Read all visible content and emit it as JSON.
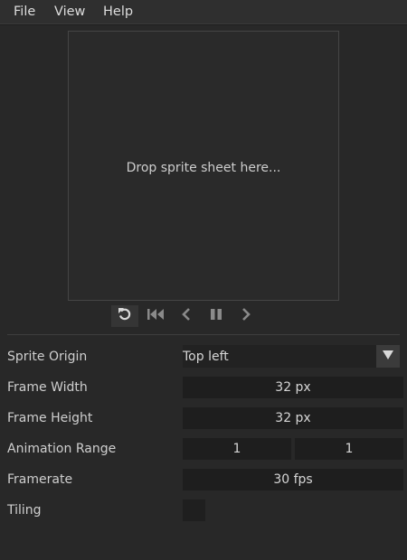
{
  "menu": {
    "file": "File",
    "view": "View",
    "help": "Help"
  },
  "preview": {
    "drop_text": "Drop sprite sheet here..."
  },
  "playback": {
    "buttons": [
      "loop-icon",
      "skip-to-start-icon",
      "previous-frame-icon",
      "pause-icon",
      "next-frame-icon"
    ]
  },
  "settings": {
    "sprite_origin": {
      "label": "Sprite Origin",
      "value": "Top left"
    },
    "frame_width": {
      "label": "Frame Width",
      "value": "32 px"
    },
    "frame_height": {
      "label": "Frame Height",
      "value": "32 px"
    },
    "animation_range": {
      "label": "Animation Range",
      "start": "1",
      "end": "1"
    },
    "framerate": {
      "label": "Framerate",
      "value": "30 fps"
    },
    "tiling": {
      "label": "Tiling",
      "checked": false
    }
  },
  "colors": {
    "background": "#282828",
    "field": "#1e1e1e",
    "text": "#cfcfcf",
    "icon": "#d0d0d0",
    "icon_dim": "#8a8a8a"
  }
}
